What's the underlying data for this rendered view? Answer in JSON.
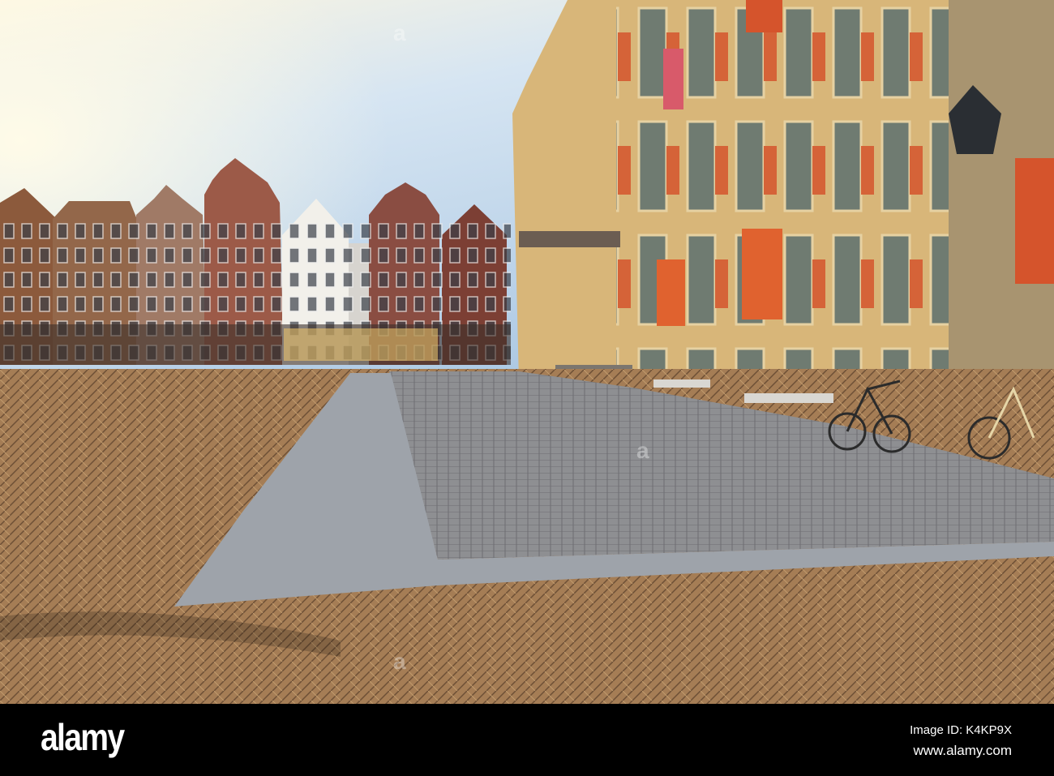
{
  "watermark": {
    "text": "a"
  },
  "footer": {
    "logo": "alamy",
    "image_id": "Image ID: K4KP9X",
    "website": "www.alamy.com"
  },
  "colors": {
    "sky": "#b9d3ea",
    "brick": "#a8805a",
    "cobble": "#8d8d8f",
    "slab": "#9ea3aa",
    "facade": "#d9b77a",
    "shutter": "#d5542c"
  }
}
